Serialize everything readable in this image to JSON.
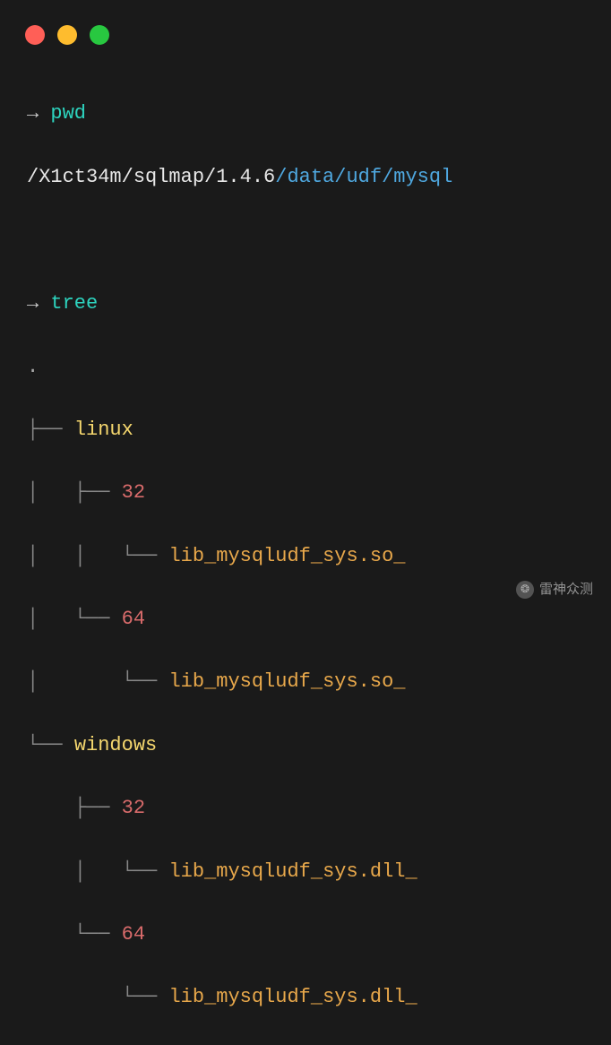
{
  "prompts": {
    "arrow": "→",
    "cmd1": "pwd",
    "cmd2": "tree"
  },
  "pwd": {
    "base": "/X1ct34m/sqlmap/1.4.6",
    "tail": "/data/udf/mysql"
  },
  "tree": {
    "root": ".",
    "l1a_pre": "├── ",
    "l1a_dir": "linux",
    "l2a_pre": "│   ├── ",
    "l2a_num": "32",
    "l3a_pre": "│   │   └── ",
    "l3a_file": "lib_mysqludf_sys.so_",
    "l2b_pre": "│   └── ",
    "l2b_num": "64",
    "l3b_pre": "│       └── ",
    "l3b_file": "lib_mysqludf_sys.so_",
    "l1b_pre": "└── ",
    "l1b_dir": "windows",
    "l2c_pre": "    ├── ",
    "l2c_num": "32",
    "l3c_pre": "    │   └── ",
    "l3c_file": "lib_mysqludf_sys.dll_",
    "l2d_pre": "    └── ",
    "l2d_num": "64",
    "l3d_pre": "        └── ",
    "l3d_file": "lib_mysqludf_sys.dll_"
  },
  "watermark": {
    "text": "雷神众测"
  }
}
